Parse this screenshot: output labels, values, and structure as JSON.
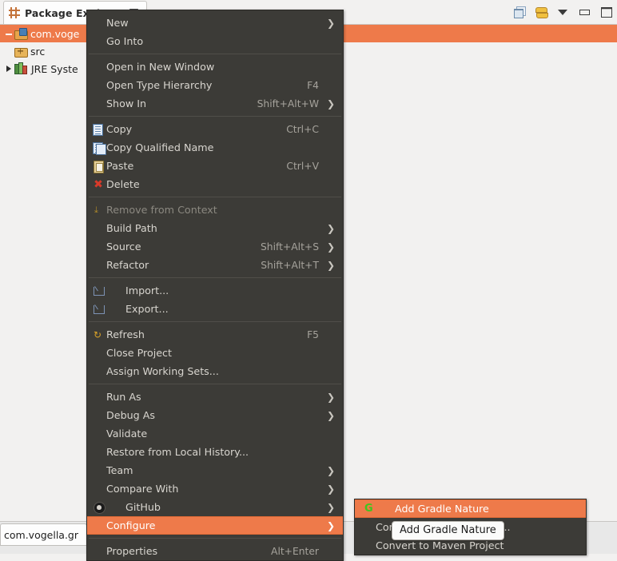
{
  "view": {
    "tab_title": "Package Explorer",
    "tab_icon": "package-explorer-icon",
    "pin_icon": "pin-icon",
    "toolbar": [
      {
        "name": "collapse-all-icon",
        "title": "Collapse All"
      },
      {
        "name": "link-with-editor-icon",
        "title": "Link with Editor"
      },
      {
        "name": "view-menu-icon",
        "title": "View Menu"
      },
      {
        "name": "minimize-icon",
        "title": "Minimize"
      },
      {
        "name": "maximize-icon",
        "title": "Maximize"
      }
    ]
  },
  "tree": {
    "items": [
      {
        "label": "com.voge",
        "icon": "java-project-icon",
        "twisty": "expanded",
        "depth": 0,
        "selected": true
      },
      {
        "label": "src",
        "icon": "source-folder-icon",
        "twisty": "none",
        "depth": 1,
        "selected": false
      },
      {
        "label": "JRE Syste",
        "icon": "jre-library-icon",
        "twisty": "collapsed",
        "depth": 0,
        "selected": false
      }
    ]
  },
  "editor": {
    "tab_label": "com.vogella.gr"
  },
  "context_menu": {
    "groups": [
      {
        "items": [
          {
            "label": "New",
            "accel": "",
            "arrow": true,
            "icon": "",
            "disabled": false,
            "highlight": false
          },
          {
            "label": "Go Into",
            "accel": "",
            "arrow": false,
            "icon": "",
            "disabled": false,
            "highlight": false
          }
        ]
      },
      {
        "items": [
          {
            "label": "Open in New Window",
            "accel": "",
            "arrow": false,
            "icon": "",
            "disabled": false,
            "highlight": false
          },
          {
            "label": "Open Type Hierarchy",
            "accel": "F4",
            "arrow": false,
            "icon": "",
            "disabled": false,
            "highlight": false
          },
          {
            "label": "Show In",
            "accel": "Shift+Alt+W",
            "arrow": true,
            "icon": "",
            "disabled": false,
            "highlight": false
          }
        ]
      },
      {
        "items": [
          {
            "label": "Copy",
            "accel": "Ctrl+C",
            "arrow": false,
            "icon": "copy-icon",
            "disabled": false,
            "highlight": false
          },
          {
            "label": "Copy Qualified Name",
            "accel": "",
            "arrow": false,
            "icon": "copy-qualified-name-icon",
            "disabled": false,
            "highlight": false
          },
          {
            "label": "Paste",
            "accel": "Ctrl+V",
            "arrow": false,
            "icon": "paste-icon",
            "disabled": false,
            "highlight": false
          },
          {
            "label": "Delete",
            "accel": "",
            "arrow": false,
            "icon": "delete-icon",
            "disabled": false,
            "highlight": false
          }
        ]
      },
      {
        "items": [
          {
            "label": "Remove from Context",
            "accel": "",
            "arrow": false,
            "icon": "remove-from-context-icon",
            "disabled": true,
            "highlight": false
          },
          {
            "label": "Build Path",
            "accel": "",
            "arrow": true,
            "icon": "",
            "disabled": false,
            "highlight": false
          },
          {
            "label": "Source",
            "accel": "Shift+Alt+S",
            "arrow": true,
            "icon": "",
            "disabled": false,
            "highlight": false
          },
          {
            "label": "Refactor",
            "accel": "Shift+Alt+T",
            "arrow": true,
            "icon": "",
            "disabled": false,
            "highlight": false
          }
        ]
      },
      {
        "items": [
          {
            "label": "Import...",
            "accel": "",
            "arrow": false,
            "icon": "import-icon",
            "disabled": false,
            "highlight": false
          },
          {
            "label": "Export...",
            "accel": "",
            "arrow": false,
            "icon": "export-icon",
            "disabled": false,
            "highlight": false
          }
        ]
      },
      {
        "items": [
          {
            "label": "Refresh",
            "accel": "F5",
            "arrow": false,
            "icon": "refresh-icon",
            "disabled": false,
            "highlight": false
          },
          {
            "label": "Close Project",
            "accel": "",
            "arrow": false,
            "icon": "",
            "disabled": false,
            "highlight": false
          },
          {
            "label": "Assign Working Sets...",
            "accel": "",
            "arrow": false,
            "icon": "",
            "disabled": false,
            "highlight": false
          }
        ]
      },
      {
        "items": [
          {
            "label": "Run As",
            "accel": "",
            "arrow": true,
            "icon": "",
            "disabled": false,
            "highlight": false
          },
          {
            "label": "Debug As",
            "accel": "",
            "arrow": true,
            "icon": "",
            "disabled": false,
            "highlight": false
          },
          {
            "label": "Validate",
            "accel": "",
            "arrow": false,
            "icon": "",
            "disabled": false,
            "highlight": false
          },
          {
            "label": "Restore from Local History...",
            "accel": "",
            "arrow": false,
            "icon": "",
            "disabled": false,
            "highlight": false
          },
          {
            "label": "Team",
            "accel": "",
            "arrow": true,
            "icon": "",
            "disabled": false,
            "highlight": false
          },
          {
            "label": "Compare With",
            "accel": "",
            "arrow": true,
            "icon": "",
            "disabled": false,
            "highlight": false
          },
          {
            "label": "GitHub",
            "accel": "",
            "arrow": true,
            "icon": "github-icon",
            "disabled": false,
            "highlight": false
          },
          {
            "label": "Configure",
            "accel": "",
            "arrow": true,
            "icon": "",
            "disabled": false,
            "highlight": true
          }
        ]
      },
      {
        "items": [
          {
            "label": "Properties",
            "accel": "Alt+Enter",
            "arrow": false,
            "icon": "",
            "disabled": false,
            "highlight": false
          }
        ]
      }
    ]
  },
  "submenu": {
    "items": [
      {
        "label": "Add Gradle Nature",
        "icon": "gradle-icon",
        "highlight": true
      },
      {
        "label": "Convert to Faceted Form...",
        "icon": "",
        "highlight": false
      },
      {
        "label": "Convert to Maven Project",
        "icon": "",
        "highlight": false
      }
    ]
  },
  "tooltip": {
    "text": "Add Gradle Nature"
  },
  "colors": {
    "menu_background": "#3c3b37",
    "menu_text": "#d8d5cf",
    "menu_disabled_text": "#8b8880",
    "highlight_orange": "#ee7a4a",
    "accel_text": "#a6a39c",
    "workbench_background": "#f2f1f0",
    "gradle_green": "#3fc51f"
  }
}
